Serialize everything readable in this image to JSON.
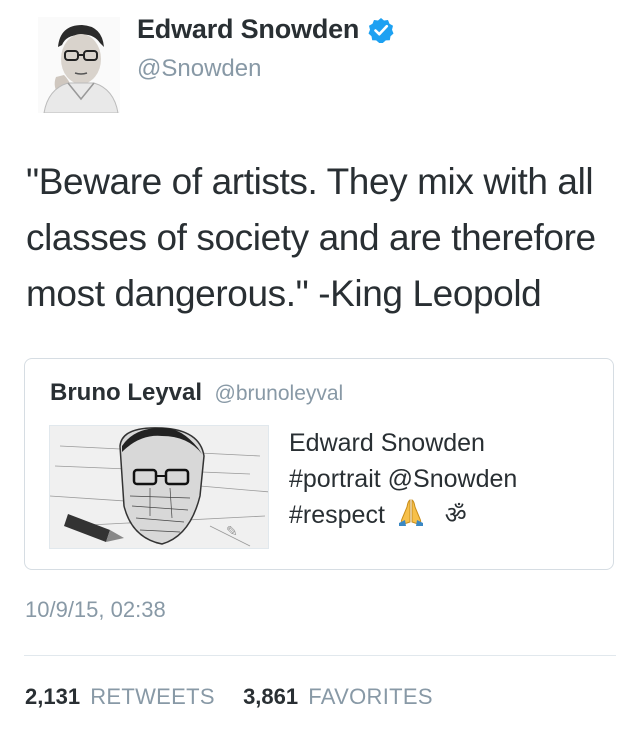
{
  "author": {
    "name": "Edward Snowden",
    "handle": "@Snowden",
    "verified": true
  },
  "tweet": {
    "line1": "\"Beware of artists. They mix with all",
    "line2": "classes of society and are therefore",
    "line3": "most dangerous.\" -King Leopold"
  },
  "quote": {
    "name": "Bruno Leyval",
    "handle": "@brunoleyval",
    "line1": "Edward Snowden",
    "line2": "#portrait @Snowden",
    "line3": "#respect",
    "om": "ॐ"
  },
  "timestamp": "10/9/15, 02:38",
  "stats": {
    "retweets_count": "2,131",
    "retweets_label": "RETWEETS",
    "favorites_count": "3,861",
    "favorites_label": "FAVORITES"
  },
  "colors": {
    "text": "#292f33",
    "muted": "#8899a6",
    "verified": "#1da1f2",
    "border": "#d6dde3"
  }
}
